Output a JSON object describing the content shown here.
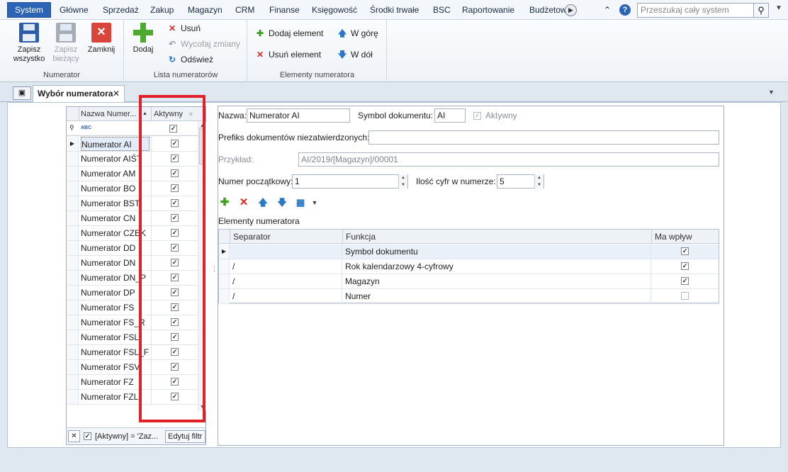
{
  "menu": {
    "tabs": [
      "System",
      "Główne",
      "Sprzedaż",
      "Zakup",
      "Magazyn",
      "CRM",
      "Finanse",
      "Księgowość",
      "Środki trwałe",
      "BSC",
      "Raportowanie",
      "Budżetow"
    ],
    "search_placeholder": "Przeszukaj cały system"
  },
  "ribbon": {
    "groups": {
      "numerator": {
        "label": "Numerator",
        "save_all": "Zapisz wszystko",
        "save_current": "Zapisz bieżący",
        "close": "Zamknij"
      },
      "list": {
        "label": "Lista numeratorów",
        "add": "Dodaj",
        "delete": "Usuń",
        "undo": "Wycofaj zmiany",
        "refresh": "Odśwież"
      },
      "elements": {
        "label": "Elementy numeratora",
        "add_element": "Dodaj element",
        "delete_element": "Usuń element",
        "up": "W górę",
        "down": "W dół"
      }
    }
  },
  "document_tab": {
    "title": "Wybór numeratora"
  },
  "left_grid": {
    "col_name": "Nazwa Numer...",
    "col_active": "Aktywny",
    "filter_text_icon": "ABC",
    "rows": [
      {
        "name": "Numerator AI",
        "active": true
      },
      {
        "name": "Numerator AIŚT",
        "active": true
      },
      {
        "name": "Numerator AM",
        "active": true
      },
      {
        "name": "Numerator BO",
        "active": true
      },
      {
        "name": "Numerator BST",
        "active": true
      },
      {
        "name": "Numerator CN",
        "active": true
      },
      {
        "name": "Numerator CZEK",
        "active": true
      },
      {
        "name": "Numerator DD",
        "active": true
      },
      {
        "name": "Numerator DN",
        "active": true
      },
      {
        "name": "Numerator DN_P",
        "active": true
      },
      {
        "name": "Numerator DP",
        "active": true
      },
      {
        "name": "Numerator FS",
        "active": true
      },
      {
        "name": "Numerator FS_R",
        "active": true
      },
      {
        "name": "Numerator FSL",
        "active": true
      },
      {
        "name": "Numerator FSL_F",
        "active": true
      },
      {
        "name": "Numerator FSV",
        "active": true
      },
      {
        "name": "Numerator FZ",
        "active": true
      },
      {
        "name": "Numerator FZL",
        "active": true
      }
    ],
    "filter_footer": "[Aktywny] = 'Zaz...",
    "edit_filter": "Edytuj filtr"
  },
  "form": {
    "name_label": "Nazwa:",
    "name_value": "Numerator AI",
    "symbol_label": "Symbol dokumentu:",
    "symbol_value": "AI",
    "active_label": "Aktywny",
    "prefix_label": "Prefiks dokumentów niezatwierdzonych:",
    "prefix_value": "",
    "example_label": "Przykład:",
    "example_value": "AI/2019/[Magazyn]/00001",
    "start_label": "Numer początkowy:",
    "start_value": "1",
    "digits_label": "Ilość cyfr w numerze:",
    "digits_value": "5",
    "elements_label": "Elementy numeratora"
  },
  "elements_grid": {
    "col_separator": "Separator",
    "col_function": "Funkcja",
    "col_influence": "Ma wpływ",
    "rows": [
      {
        "separator": "",
        "function": "Symbol dokumentu",
        "influence": true
      },
      {
        "separator": "/",
        "function": "Rok kalendarzowy 4-cyfrowy",
        "influence": true
      },
      {
        "separator": "/",
        "function": "Magazyn",
        "influence": true
      },
      {
        "separator": "/",
        "function": "Numer",
        "influence": false
      }
    ]
  },
  "colors": {
    "accent": "#2b64b4",
    "highlight_frame": "#e2202a",
    "add_green": "#4daa2c",
    "delete_red": "#d42a1f"
  }
}
